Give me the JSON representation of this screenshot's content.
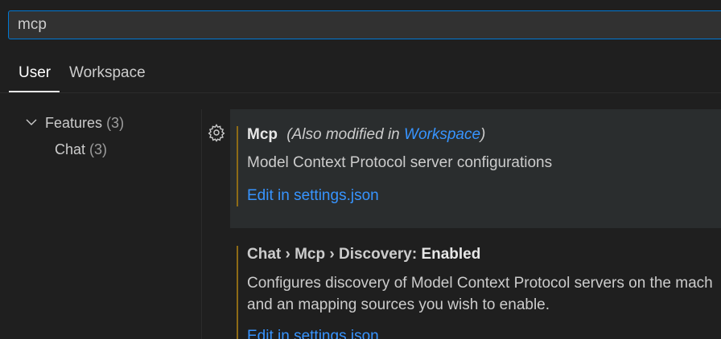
{
  "search": {
    "value": "mcp"
  },
  "tabs": [
    {
      "label": "User"
    },
    {
      "label": "Workspace"
    }
  ],
  "toc": {
    "items": [
      {
        "label": "Features",
        "count": "(3)"
      },
      {
        "label": "Chat",
        "count": "(3)"
      }
    ]
  },
  "settings": [
    {
      "title": "Mcp",
      "modified_prefix": "(Also modified in ",
      "modified_link": "Workspace",
      "modified_suffix": ")",
      "description": "Model Context Protocol server configurations",
      "edit_link": "Edit in settings.json"
    },
    {
      "category": "Chat › Mcp › Discovery: ",
      "title": "Enabled",
      "description_line1": "Configures discovery of Model Context Protocol servers on the mach",
      "description_line2": "and an mapping sources you wish to enable.",
      "edit_link": "Edit in settings.json"
    }
  ],
  "colors": {
    "accent": "#0078d4",
    "link": "#3794ff",
    "modified_indicator": "#8e6b16",
    "background": "#1f1f1f",
    "focused_row": "#2a2d2e"
  },
  "icons": {
    "toc_chevron": "chevron-down-icon",
    "setting_gear": "gear-icon"
  }
}
